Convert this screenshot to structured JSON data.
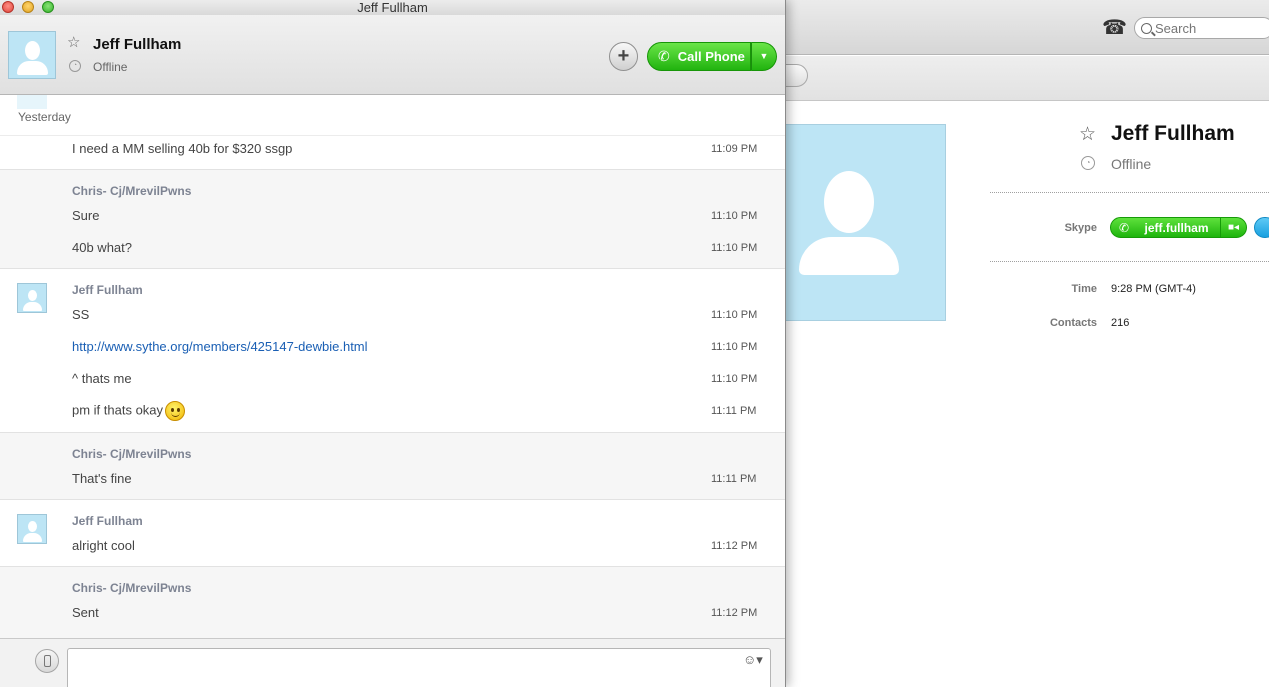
{
  "window": {
    "title": "Jeff Fullham"
  },
  "background": {
    "search_placeholder": "Search",
    "profile": {
      "name": "Jeff Fullham",
      "status": "Offline",
      "properties": [
        {
          "label": "Skype",
          "value": "jeff.fullham"
        },
        {
          "label": "Time",
          "value": "9:28 PM (GMT-4)"
        },
        {
          "label": "Contacts",
          "value": "216"
        }
      ]
    }
  },
  "header": {
    "contact_name": "Jeff Fullham",
    "status": "Offline",
    "call_label": "Call Phone"
  },
  "chat": {
    "date_label": "Yesterday",
    "groups": [
      {
        "sender": "",
        "lines": [
          {
            "text": "I need a MM selling 40b for $320 ssgp",
            "time": "11:09 PM"
          }
        ]
      },
      {
        "sender": "Chris- Cj/MrevilPwns",
        "lines": [
          {
            "text": "Sure",
            "time": "11:10 PM"
          },
          {
            "text": "40b what?",
            "time": "11:10 PM"
          }
        ]
      },
      {
        "sender": "Jeff Fullham",
        "lines": [
          {
            "text": "SS",
            "time": "11:10 PM"
          },
          {
            "text": "http://www.sythe.org/members/425147-dewbie.html",
            "time": "11:10 PM"
          },
          {
            "text": "^ thats me",
            "time": "11:10 PM"
          },
          {
            "text": "pm if thats okay",
            "time": "11:11 PM"
          }
        ]
      },
      {
        "sender": "Chris- Cj/MrevilPwns",
        "lines": [
          {
            "text": "That's fine",
            "time": "11:11 PM"
          }
        ]
      },
      {
        "sender": "Jeff Fullham",
        "lines": [
          {
            "text": "alright cool",
            "time": "11:12 PM"
          }
        ]
      },
      {
        "sender": "Chris- Cj/MrevilPwns",
        "lines": [
          {
            "text": "Sent",
            "time": "11:12 PM"
          }
        ]
      }
    ]
  },
  "icons": {
    "star": "star-icon",
    "offline": "offline-status-icon",
    "phone": "phone-icon",
    "add": "plus-icon",
    "smiley": "smiley-emoticon-icon",
    "mobile": "mobile-phone-icon"
  }
}
